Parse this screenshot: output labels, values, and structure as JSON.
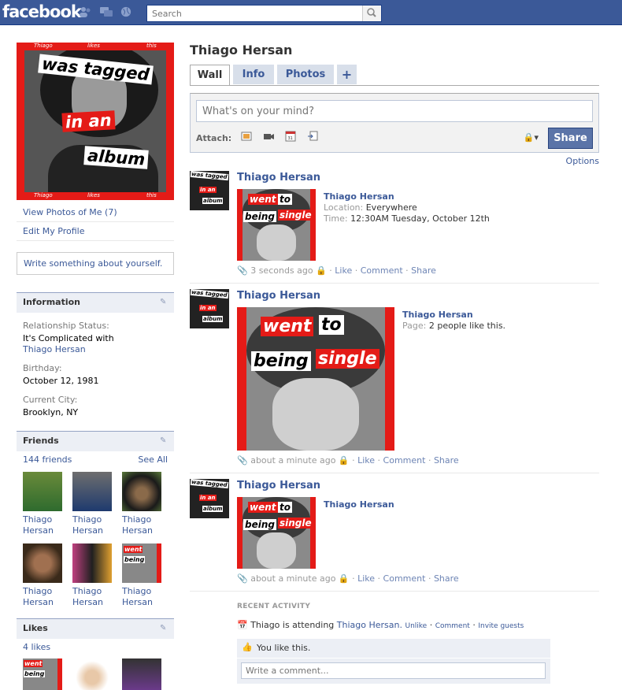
{
  "topbar": {
    "logo": "facebook",
    "search_placeholder": "Search"
  },
  "sidebar": {
    "profile_pic": {
      "tag_line1": "was tagged",
      "tag_line2": "in an",
      "tag_line3": "album",
      "edge_words": [
        "Thiago",
        "likes",
        "this"
      ]
    },
    "links": [
      "View Photos of Me (7)",
      "Edit My Profile"
    ],
    "write_about": "Write something about yourself.",
    "information": {
      "title": "Information",
      "relationship_label": "Relationship Status:",
      "relationship_value": "It's Complicated with",
      "relationship_link": "Thiago Hersan",
      "birthday_label": "Birthday:",
      "birthday_value": "October 12, 1981",
      "city_label": "Current City:",
      "city_value": "Brooklyn, NY"
    },
    "friends": {
      "title": "Friends",
      "count": "144 friends",
      "see_all": "See All",
      "names": [
        [
          "Thiago",
          "Hersan"
        ],
        [
          "Thiago",
          "Hersan"
        ],
        [
          "Thiago",
          "Hersan"
        ],
        [
          "Thiago",
          "Hersan"
        ],
        [
          "Thiago",
          "Hersan"
        ],
        [
          "Thiago",
          "Hersan"
        ]
      ]
    },
    "likes": {
      "title": "Likes",
      "count": "4 likes"
    }
  },
  "main": {
    "title": "Thiago Hersan",
    "tabs": [
      "Wall",
      "Info",
      "Photos",
      "+"
    ],
    "composer": {
      "placeholder": "What's on your mind?",
      "attach_label": "Attach:",
      "share": "Share"
    },
    "options": "Options",
    "stories": [
      {
        "name": "Thiago Hersan",
        "att_title": "Thiago Hersan",
        "location_label": "Location:",
        "location": "Everywhere",
        "time_label": "Time:",
        "time": "12:30AM Tuesday, October 12th",
        "when": "3 seconds ago",
        "actions": [
          "Like",
          "Comment",
          "Share"
        ],
        "img_text1": "went",
        "img_text2": "to",
        "img_text3": "being",
        "img_text4": "single",
        "avatar_text": [
          "was tagged",
          "in an",
          "album"
        ]
      },
      {
        "name": "Thiago Hersan",
        "att_title": "Thiago Hersan",
        "page_label": "Page:",
        "page_value": "2 people like this.",
        "when": "about a minute ago",
        "actions": [
          "Like",
          "Comment",
          "Share"
        ]
      },
      {
        "name": "Thiago Hersan",
        "att_title": "Thiago Hersan",
        "when": "about a minute ago",
        "actions": [
          "Like",
          "Comment",
          "Share"
        ]
      }
    ],
    "recent": {
      "header": "RECENT ACTIVITY",
      "text": "Thiago is attending",
      "link": "Thiago Hersan.",
      "actions": [
        "Unlike",
        "Comment",
        "Invite guests"
      ],
      "you_like": "You like this.",
      "comment_placeholder": "Write a comment..."
    }
  },
  "colors": {
    "brand": "#3b5998",
    "accent_red": "#e41b17"
  }
}
